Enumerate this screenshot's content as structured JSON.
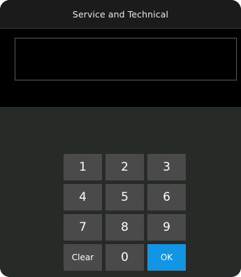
{
  "header": {
    "title": "Service and Technical"
  },
  "code_input": {
    "value": ""
  },
  "keypad": {
    "keys": [
      "1",
      "2",
      "3",
      "4",
      "5",
      "6",
      "7",
      "8",
      "9",
      "Clear",
      "0",
      "OK"
    ]
  },
  "colors": {
    "background": "#000000",
    "title_bar": "#1b1b1b",
    "panel": "#262b27",
    "key": "#4a4a4a",
    "accent": "#1195e4"
  }
}
